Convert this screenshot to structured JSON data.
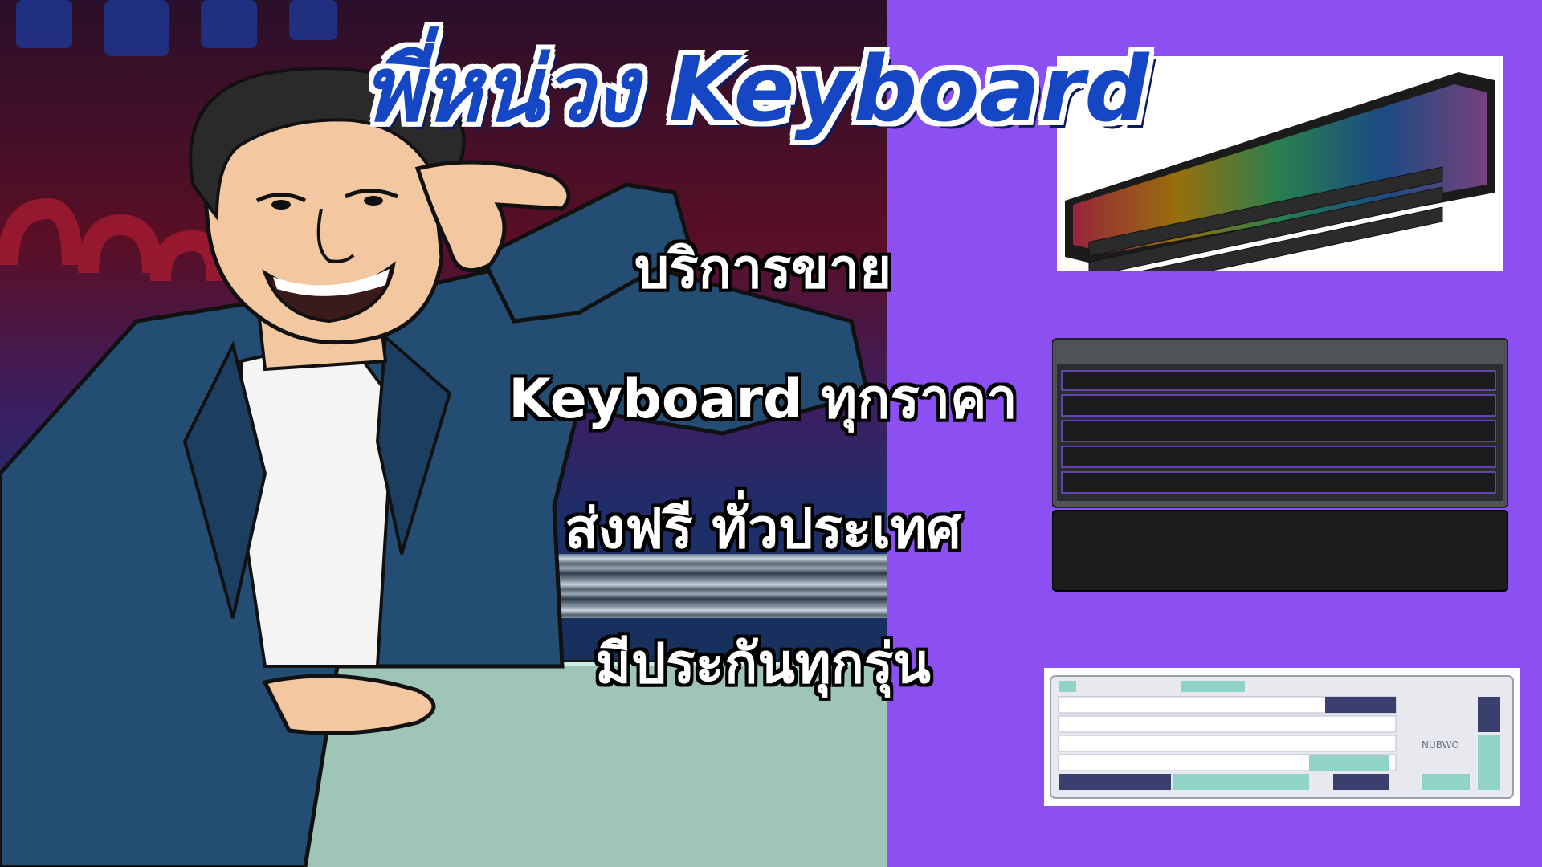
{
  "title": "พี่หน่วง Keyboard",
  "lines": [
    "บริการขาย",
    "Keyboard ทุกราคา",
    "ส่งฟรี ทั่วประเทศ",
    "มีประกันทุกรุ่น"
  ],
  "colors": {
    "title_fill": "#1546c4",
    "title_outline": "#ffffff",
    "panel_bg": "#8b4ff2",
    "text_fill": "#ffffff",
    "text_outline": "#000000"
  },
  "images": {
    "character": "cartoon-presenter-man-pointing-head",
    "keyboard_1": "rgb-mechanical-keyboard",
    "keyboard_2": "gray-gaming-keyboard-with-wrist-rest",
    "keyboard_3": "white-teal-navy-keyboard"
  },
  "keyboard_3_brand": "NUBWO"
}
